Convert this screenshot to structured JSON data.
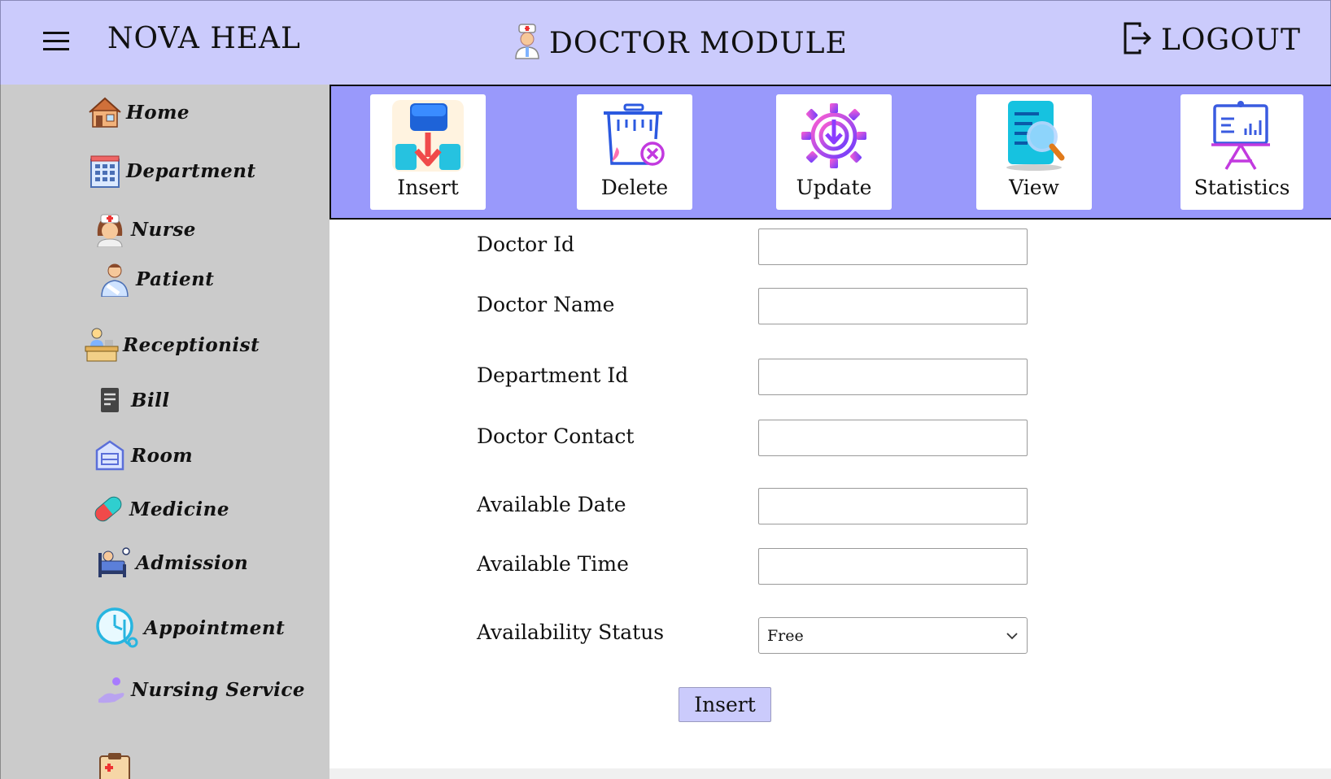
{
  "header": {
    "brand": "NOVA HEAL",
    "module_title": "DOCTOR MODULE",
    "logout_label": "LOGOUT"
  },
  "sidebar": {
    "items": [
      {
        "label": "Home",
        "icon": "house-icon"
      },
      {
        "label": "Department",
        "icon": "hospital-building-icon"
      },
      {
        "label": "Nurse",
        "icon": "nurse-icon"
      },
      {
        "label": "Patient",
        "icon": "patient-icon"
      },
      {
        "label": "Receptionist",
        "icon": "reception-desk-icon"
      },
      {
        "label": "Bill",
        "icon": "bill-icon"
      },
      {
        "label": "Room",
        "icon": "room-icon"
      },
      {
        "label": "Medicine",
        "icon": "pill-capsule-icon"
      },
      {
        "label": "Admission",
        "icon": "hospital-bed-icon"
      },
      {
        "label": "Appointment",
        "icon": "clock-stethoscope-icon"
      },
      {
        "label": "Nursing Service",
        "icon": "caring-hand-icon"
      }
    ]
  },
  "toolbar": {
    "insert_label": "Insert",
    "delete_label": "Delete",
    "update_label": "Update",
    "view_label": "View",
    "statistics_label": "Statistics"
  },
  "form": {
    "doctor_id_label": "Doctor Id",
    "doctor_id_value": "",
    "doctor_name_label": "Doctor Name",
    "doctor_name_value": "",
    "department_id_label": "Department Id",
    "department_id_value": "",
    "doctor_contact_label": "Doctor Contact",
    "doctor_contact_value": "",
    "available_date_label": "Available Date",
    "available_date_value": "",
    "available_time_label": "Available Time",
    "available_time_value": "",
    "availability_status_label": "Availability Status",
    "availability_status_value": "Free",
    "submit_label": "Insert"
  },
  "colors": {
    "header_bg": "#cbcbfc",
    "toolbar_bg": "#9999fb",
    "sidebar_bg": "#cbcbcb",
    "submit_bg": "#cbcbfc"
  }
}
